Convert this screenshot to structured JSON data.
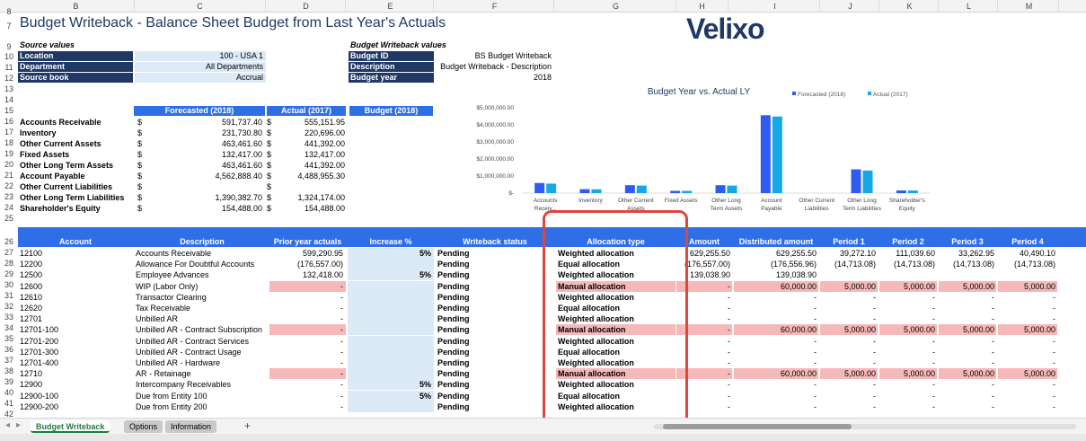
{
  "columns": [
    "B",
    "C",
    "D",
    "E",
    "F",
    "G",
    "H",
    "I",
    "J",
    "K",
    "L",
    "M"
  ],
  "rows": [
    "7",
    "8",
    "9",
    "10",
    "11",
    "12",
    "13",
    "14",
    "15",
    "16",
    "17",
    "18",
    "19",
    "20",
    "21",
    "22",
    "23",
    "24",
    "25",
    "26",
    "27",
    "28",
    "29",
    "30",
    "31",
    "32",
    "33",
    "34",
    "35",
    "36",
    "37",
    "38",
    "39",
    "40",
    "41",
    "42"
  ],
  "title": "Budget Writeback - Balance Sheet Budget from Last Year's Actuals",
  "logo": "Velixo",
  "source": {
    "header": "Source values",
    "items": [
      {
        "label": "Location",
        "value": "100 - USA 1"
      },
      {
        "label": "Department",
        "value": "All Departments"
      },
      {
        "label": "Source book",
        "value": "Accrual"
      }
    ]
  },
  "writeback": {
    "header": "Budget Writeback values",
    "items": [
      {
        "label": "Budget ID",
        "value": "BS Budget Writeback"
      },
      {
        "label": "Description",
        "value": "Budget Writeback - Description"
      },
      {
        "label": "Budget year",
        "value": "2018"
      }
    ]
  },
  "summary": {
    "headers": [
      "Forecasted (2018)",
      "Actual (2017)",
      "Budget (2018)"
    ],
    "currency": "$",
    "rows": [
      {
        "label": "Accounts Receivable",
        "forecast": "591,737.40",
        "actual": "555,151.95"
      },
      {
        "label": "Inventory",
        "forecast": "231,730.80",
        "actual": "220,696.00"
      },
      {
        "label": "Other Current Assets",
        "forecast": "463,461.60",
        "actual": "441,392.00"
      },
      {
        "label": "Fixed Assets",
        "forecast": "132,417.00",
        "actual": "132,417.00"
      },
      {
        "label": "Other Long Term Assets",
        "forecast": "463,461.60",
        "actual": "441,392.00"
      },
      {
        "label": "Account Payable",
        "forecast": "4,562,888.40",
        "actual": "4,488,955.30"
      },
      {
        "label": "Other Current Liabilities",
        "forecast": "",
        "actual": ""
      },
      {
        "label": "Other Long Term Liabilities",
        "forecast": "1,390,382.70",
        "actual": "1,324,174.00"
      },
      {
        "label": "Shareholder's Equity",
        "forecast": "154,488.00",
        "actual": "154,488.00"
      }
    ]
  },
  "chart_data": {
    "type": "bar",
    "title": "Budget Year vs. Actual LY",
    "categories": [
      "Accounts Receivable",
      "Inventory",
      "Other Current Assets",
      "Fixed Assets",
      "Other Long Term Assets",
      "Account Payable",
      "Other Current Liabilities",
      "Other Long Term Liabilities",
      "Shareholder's Equity"
    ],
    "category_labels": [
      [
        "Accounts",
        "Receiv..."
      ],
      [
        "Inventory"
      ],
      [
        "Other Current",
        "Assets"
      ],
      [
        "Fixed Assets"
      ],
      [
        "Other Long",
        "Term Assets"
      ],
      [
        "Account",
        "Payable"
      ],
      [
        "Other Current",
        "Liabilities"
      ],
      [
        "Other Long",
        "Term Liabilities"
      ],
      [
        "Shareholder's",
        "Equity"
      ]
    ],
    "series": [
      {
        "name": "Forecasted (2018)",
        "color": "#2f5cf0",
        "values": [
          591737.4,
          231730.8,
          463461.6,
          132417.0,
          463461.6,
          4562888.4,
          0,
          1390382.7,
          154488.0
        ]
      },
      {
        "name": "Actual (2017)",
        "color": "#16a7e6",
        "values": [
          555151.95,
          220696.0,
          441392.0,
          132417.0,
          441392.0,
          4488955.3,
          0,
          1324174.0,
          154488.0
        ]
      }
    ],
    "yticks": [
      "$-",
      "$1,000,000.00",
      "$2,000,000.00",
      "$3,000,000.00",
      "$4,000,000.00",
      "$5,000,000.00"
    ],
    "ylim": [
      0,
      5000000
    ],
    "legend": "top-right"
  },
  "table": {
    "headers": [
      "Account",
      "Description",
      "Prior year actuals",
      "Increase %",
      "Writeback status",
      "Allocation type",
      "Amount",
      "Distributed amount",
      "Period 1",
      "Period 2",
      "Period 3",
      "Period 4"
    ],
    "rows": [
      {
        "acct": "12100",
        "desc": "Accounts Receivable",
        "prior": "599,290.95",
        "incr": "5%",
        "status": "Pending",
        "alloc": "Weighted allocation",
        "amt": "629,255.50",
        "dist": "629,255.50",
        "p1": "39,272.10",
        "p2": "111,039.60",
        "p3": "33,262.95",
        "p4": "40,490.10",
        "pink": false
      },
      {
        "acct": "12200",
        "desc": "Allowance For Doubtful Accounts",
        "prior": "(176,557.00)",
        "incr": "",
        "status": "Pending",
        "alloc": "Equal allocation",
        "amt": "(176,557.00)",
        "dist": "(176,556.96)",
        "p1": "(14,713.08)",
        "p2": "(14,713.08)",
        "p3": "(14,713.08)",
        "p4": "(14,713.08)",
        "pink": false
      },
      {
        "acct": "12500",
        "desc": "Employee Advances",
        "prior": "132,418.00",
        "incr": "5%",
        "status": "Pending",
        "alloc": "Weighted allocation",
        "amt": "139,038.90",
        "dist": "139,038.90",
        "p1": "",
        "p2": "",
        "p3": "",
        "p4": "",
        "pink": false
      },
      {
        "acct": "12600",
        "desc": "WIP (Labor Only)",
        "prior": "-",
        "incr": "",
        "status": "Pending",
        "alloc": "Manual allocation",
        "amt": "-",
        "dist": "60,000.00",
        "p1": "5,000.00",
        "p2": "5,000.00",
        "p3": "5,000.00",
        "p4": "5,000.00",
        "pink": true
      },
      {
        "acct": "12610",
        "desc": "Transactor Clearing",
        "prior": "-",
        "incr": "",
        "status": "Pending",
        "alloc": "Weighted allocation",
        "amt": "-",
        "dist": "-",
        "p1": "-",
        "p2": "-",
        "p3": "-",
        "p4": "-",
        "pink": false
      },
      {
        "acct": "12620",
        "desc": "Tax Receivable",
        "prior": "-",
        "incr": "",
        "status": "Pending",
        "alloc": "Equal allocation",
        "amt": "-",
        "dist": "-",
        "p1": "-",
        "p2": "-",
        "p3": "-",
        "p4": "-",
        "pink": false
      },
      {
        "acct": "12701",
        "desc": "Unbilled AR",
        "prior": "-",
        "incr": "",
        "status": "Pending",
        "alloc": "Weighted allocation",
        "amt": "-",
        "dist": "-",
        "p1": "-",
        "p2": "-",
        "p3": "-",
        "p4": "-",
        "pink": false
      },
      {
        "acct": "12701-100",
        "desc": "Unbilled AR - Contract Subscription",
        "prior": "-",
        "incr": "",
        "status": "Pending",
        "alloc": "Manual allocation",
        "amt": "-",
        "dist": "60,000.00",
        "p1": "5,000.00",
        "p2": "5,000.00",
        "p3": "5,000.00",
        "p4": "5,000.00",
        "pink": true
      },
      {
        "acct": "12701-200",
        "desc": "Unbilled AR - Contract Services",
        "prior": "-",
        "incr": "",
        "status": "Pending",
        "alloc": "Weighted allocation",
        "amt": "-",
        "dist": "-",
        "p1": "-",
        "p2": "-",
        "p3": "-",
        "p4": "-",
        "pink": false
      },
      {
        "acct": "12701-300",
        "desc": "Unbilled AR - Contract Usage",
        "prior": "-",
        "incr": "",
        "status": "Pending",
        "alloc": "Equal allocation",
        "amt": "-",
        "dist": "-",
        "p1": "-",
        "p2": "-",
        "p3": "-",
        "p4": "-",
        "pink": false
      },
      {
        "acct": "12701-400",
        "desc": "Unbilled AR - Hardware",
        "prior": "-",
        "incr": "",
        "status": "Pending",
        "alloc": "Weighted allocation",
        "amt": "-",
        "dist": "-",
        "p1": "-",
        "p2": "-",
        "p3": "-",
        "p4": "-",
        "pink": false
      },
      {
        "acct": "12710",
        "desc": "AR - Retainage",
        "prior": "-",
        "incr": "",
        "status": "Pending",
        "alloc": "Manual allocation",
        "amt": "-",
        "dist": "60,000.00",
        "p1": "5,000.00",
        "p2": "5,000.00",
        "p3": "5,000.00",
        "p4": "5,000.00",
        "pink": true
      },
      {
        "acct": "12900",
        "desc": "Intercompany Receivables",
        "prior": "-",
        "incr": "5%",
        "status": "Pending",
        "alloc": "Weighted allocation",
        "amt": "-",
        "dist": "-",
        "p1": "-",
        "p2": "-",
        "p3": "-",
        "p4": "-",
        "pink": false
      },
      {
        "acct": "12900-100",
        "desc": "Due from Entity 100",
        "prior": "-",
        "incr": "5%",
        "status": "Pending",
        "alloc": "Equal allocation",
        "amt": "-",
        "dist": "-",
        "p1": "-",
        "p2": "-",
        "p3": "-",
        "p4": "-",
        "pink": false
      },
      {
        "acct": "12900-200",
        "desc": "Due from Entity 200",
        "prior": "-",
        "incr": "",
        "status": "Pending",
        "alloc": "Weighted allocation",
        "amt": "-",
        "dist": "-",
        "p1": "-",
        "p2": "-",
        "p3": "-",
        "p4": "-",
        "pink": false
      }
    ]
  },
  "tabs": [
    {
      "label": "Budget Writeback",
      "active": true
    },
    {
      "label": "Options",
      "active": false
    },
    {
      "label": "Information",
      "active": false
    }
  ],
  "add_sheet_icon": "plus-icon"
}
